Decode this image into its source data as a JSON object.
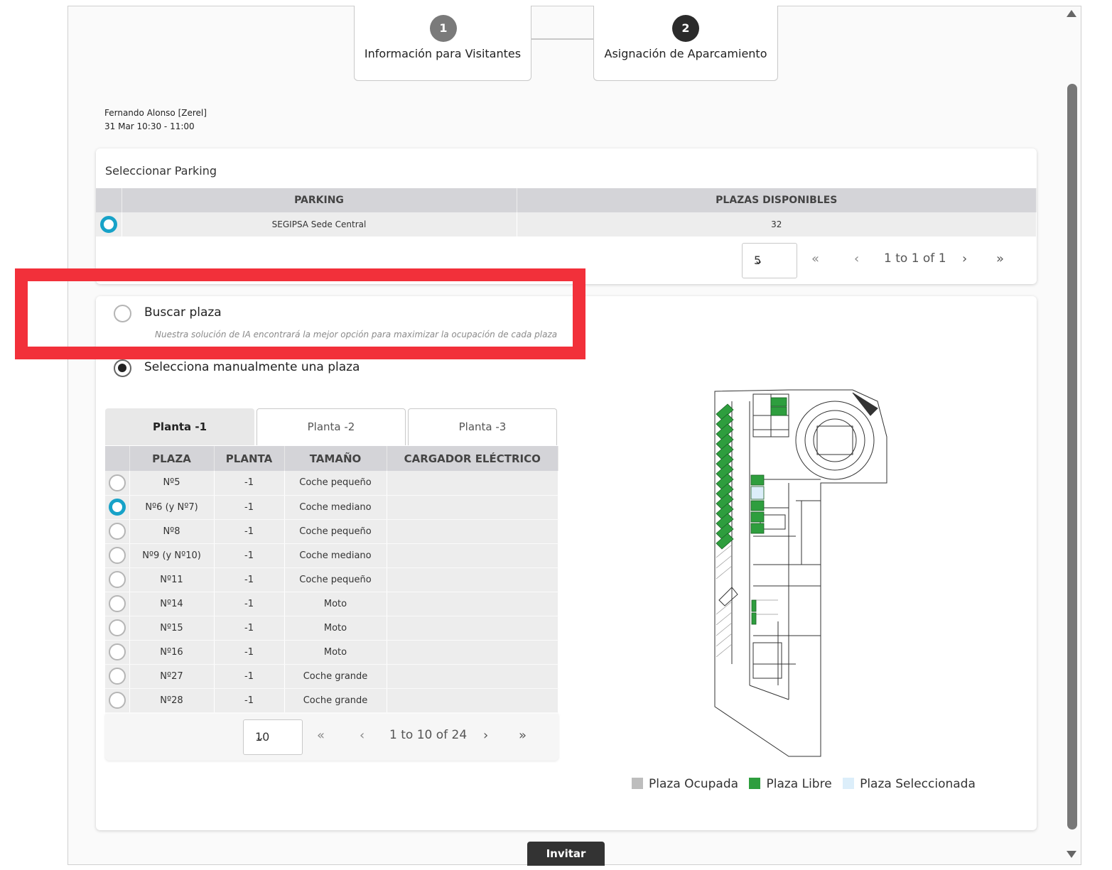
{
  "stepper": {
    "steps": [
      {
        "number": "1",
        "label": "Información para Visitantes",
        "state": "inactive"
      },
      {
        "number": "2",
        "label": "Asignación de Aparcamiento",
        "state": "active"
      }
    ]
  },
  "visitor": {
    "name": "Fernando Alonso [Zerel]",
    "time": "31 Mar 10:30 - 11:00"
  },
  "parking": {
    "title": "Seleccionar Parking",
    "columns": [
      "PARKING",
      "PLAZAS DISPONIBLES"
    ],
    "rows": [
      {
        "name": "SEGIPSA Sede Central",
        "available": "32",
        "selected": true
      }
    ],
    "pager": {
      "page_size": "5",
      "range": "1 to 1 of 1"
    }
  },
  "assignment": {
    "option_auto": {
      "label": "Buscar plaza",
      "note": "Nuestra solución de IA encontrará la mejor opción para maximizar la ocupación de cada plaza",
      "selected": false
    },
    "option_manual": {
      "label": "Selecciona manualmente una plaza",
      "selected": true
    },
    "tabs": [
      "Planta -1",
      "Planta -2",
      "Planta -3"
    ],
    "active_tab": "Planta -1",
    "columns": [
      "PLAZA",
      "PLANTA",
      "TAMAÑO",
      "CARGADOR ELÉCTRICO"
    ],
    "rows": [
      {
        "plaza": "Nº5",
        "planta": "-1",
        "tamano": "Coche pequeño",
        "cargador": "",
        "selected": false
      },
      {
        "plaza": "Nº6 (y Nº7)",
        "planta": "-1",
        "tamano": "Coche mediano",
        "cargador": "",
        "selected": true
      },
      {
        "plaza": "Nº8",
        "planta": "-1",
        "tamano": "Coche pequeño",
        "cargador": "",
        "selected": false
      },
      {
        "plaza": "Nº9 (y Nº10)",
        "planta": "-1",
        "tamano": "Coche mediano",
        "cargador": "",
        "selected": false
      },
      {
        "plaza": "Nº11",
        "planta": "-1",
        "tamano": "Coche pequeño",
        "cargador": "",
        "selected": false
      },
      {
        "plaza": "Nº14",
        "planta": "-1",
        "tamano": "Moto",
        "cargador": "",
        "selected": false
      },
      {
        "plaza": "Nº15",
        "planta": "-1",
        "tamano": "Moto",
        "cargador": "",
        "selected": false
      },
      {
        "plaza": "Nº16",
        "planta": "-1",
        "tamano": "Moto",
        "cargador": "",
        "selected": false
      },
      {
        "plaza": "Nº27",
        "planta": "-1",
        "tamano": "Coche grande",
        "cargador": "",
        "selected": false
      },
      {
        "plaza": "Nº28",
        "planta": "-1",
        "tamano": "Coche grande",
        "cargador": "",
        "selected": false
      }
    ],
    "pager": {
      "page_size": "10",
      "range": "1 to 10 of 24"
    }
  },
  "legend": [
    {
      "label": "Plaza Ocupada",
      "color": "#bdbdbd"
    },
    {
      "label": "Plaza Libre",
      "color": "#2e9e3e"
    },
    {
      "label": "Plaza Seleccionada",
      "color": "#dceefa"
    }
  ],
  "actions": {
    "invite_label": "Invitar"
  },
  "colors": {
    "accent": "#17a2c8",
    "highlight": "#f2303a",
    "free": "#2e9e3e"
  }
}
